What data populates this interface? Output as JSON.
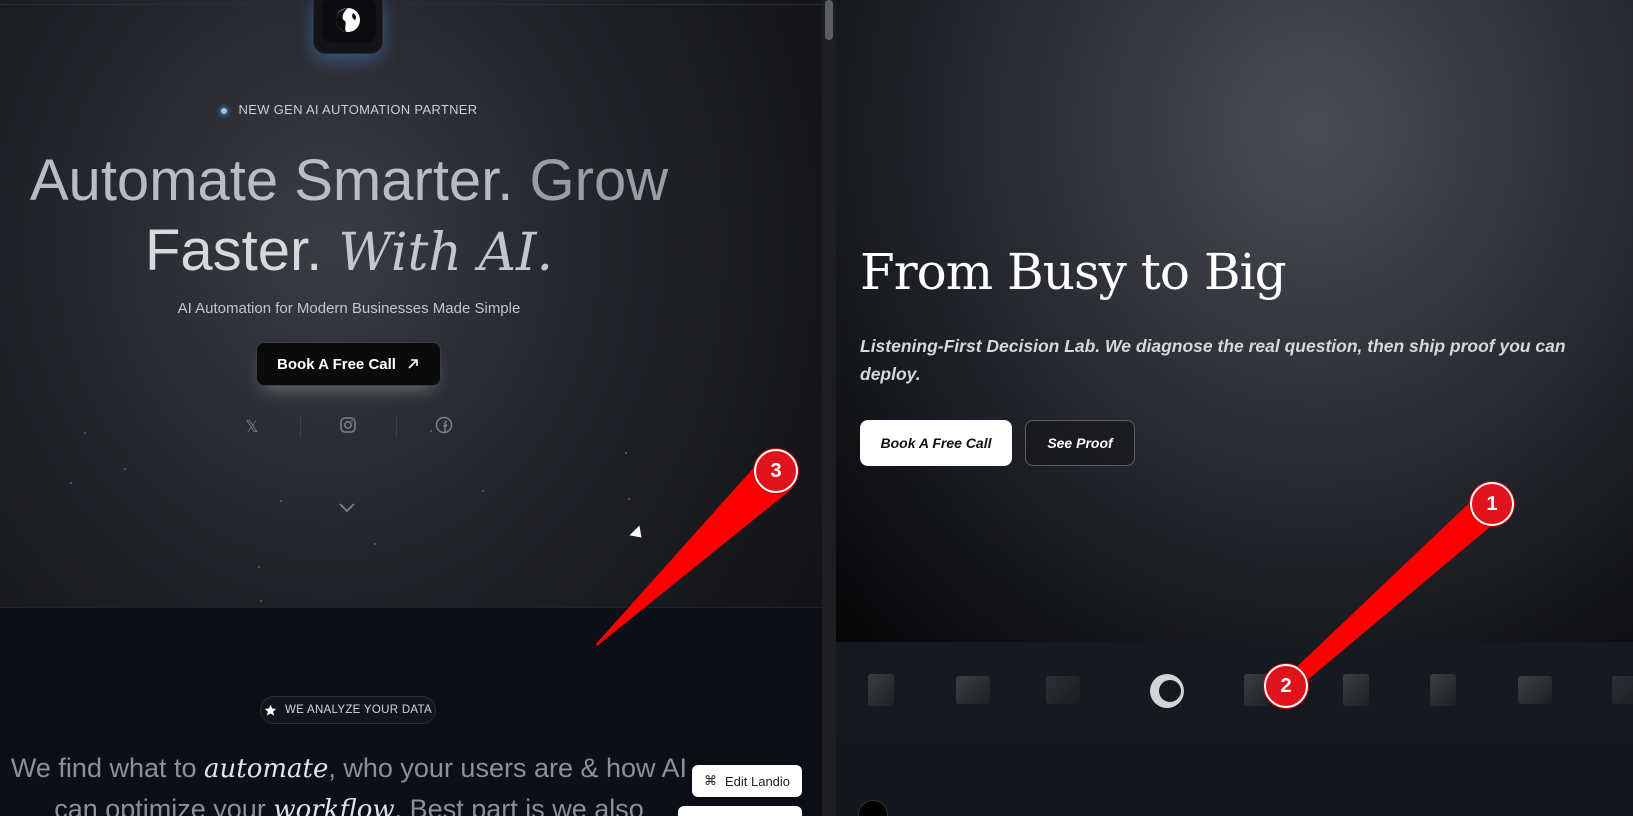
{
  "left": {
    "badge": "NEW GEN AI AUTOMATION PARTNER",
    "title_line1_a": "Automate Smarter.",
    "title_line1_b": "Grow",
    "title_line2_a": "Faster.",
    "title_line2_b": "With AI.",
    "subtitle": "AI Automation for Modern Businesses Made Simple",
    "cta_label": "Book A Free Call",
    "cta_icon": "arrow-up-right-icon",
    "socials": [
      "x-icon",
      "instagram-icon",
      "facebook-icon"
    ],
    "scroll_icon": "chevron-down-icon",
    "section_badge": "WE ANALYZE YOUR DATA",
    "section_text_pre": "We find what to ",
    "section_text_em1": "automate",
    "section_text_mid": ", who your users are & how AI can optimize your ",
    "section_text_em2": "workflow",
    "section_text_post": ". Best part is we also",
    "edit_button": "Edit Landio",
    "edit_icon": "command-icon"
  },
  "right": {
    "title": "From Busy to Big",
    "subtitle": "Listening-First Decision Lab. We diagnose the real question, then ship proof you can deploy.",
    "cta_primary": "Book A Free Call",
    "cta_secondary": "See Proof"
  },
  "annotations": {
    "markers": [
      "1",
      "2",
      "3"
    ],
    "color": "#e0121b"
  }
}
